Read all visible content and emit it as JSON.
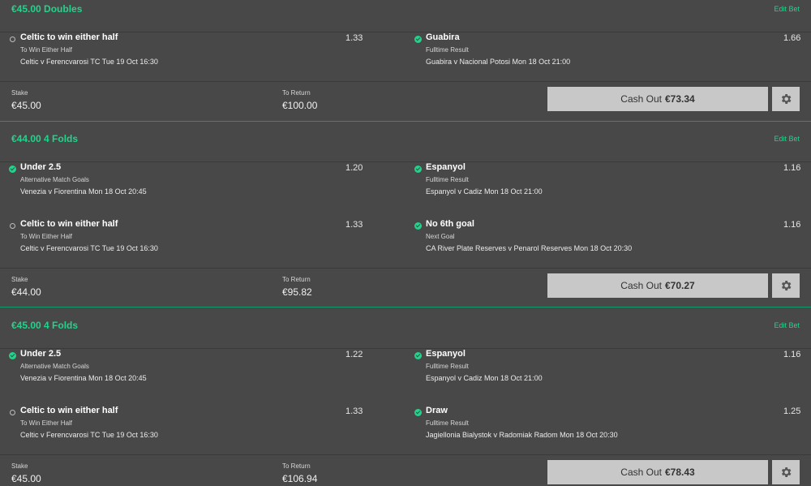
{
  "colors": {
    "accent": "#22d38c",
    "background": "#484848",
    "cashout_bg": "#c8c8c8"
  },
  "icons": {
    "won": "check-circle-icon",
    "open": "open-circle-icon",
    "settings": "gear-icon"
  },
  "bets": [
    {
      "title": "€45.00 Doubles",
      "edit_label": "Edit Bet",
      "legs": [
        {
          "status": "open",
          "selection": "Celtic to win either half",
          "market": "To Win Either Half",
          "event": "Celtic v Ferencvarosi TC   Tue 19 Oct 16:30",
          "odds": "1.33"
        },
        {
          "status": "won",
          "selection": "Guabira",
          "market": "Fulltime Result",
          "event": "Guabira v Nacional Potosi   Mon 18 Oct 21:00",
          "odds": "1.66"
        }
      ],
      "stake_label": "Stake",
      "stake": "€45.00",
      "return_label": "To Return",
      "return": "€100.00",
      "cashout_label": "Cash Out",
      "cashout_value": "€73.34"
    },
    {
      "title": "€44.00 4 Folds",
      "edit_label": "Edit Bet",
      "legs": [
        {
          "status": "won",
          "selection": "Under 2.5",
          "market": "Alternative Match Goals",
          "event": "Venezia v Fiorentina   Mon 18 Oct 20:45",
          "odds": "1.20"
        },
        {
          "status": "won",
          "selection": "Espanyol",
          "market": "Fulltime Result",
          "event": "Espanyol v Cadiz   Mon 18 Oct 21:00",
          "odds": "1.16"
        },
        {
          "status": "open",
          "selection": "Celtic to win either half",
          "market": "To Win Either Half",
          "event": "Celtic v Ferencvarosi TC   Tue 19 Oct 16:30",
          "odds": "1.33"
        },
        {
          "status": "won",
          "selection": "No 6th goal",
          "market": "Next Goal",
          "event": "CA River Plate Reserves v Penarol Reserves   Mon 18 Oct 20:30",
          "odds": "1.16"
        }
      ],
      "stake_label": "Stake",
      "stake": "€44.00",
      "return_label": "To Return",
      "return": "€95.82",
      "cashout_label": "Cash Out",
      "cashout_value": "€70.27"
    },
    {
      "title": "€45.00 4 Folds",
      "edit_label": "Edit Bet",
      "legs": [
        {
          "status": "won",
          "selection": "Under 2.5",
          "market": "Alternative Match Goals",
          "event": "Venezia v Fiorentina   Mon 18 Oct 20:45",
          "odds": "1.22"
        },
        {
          "status": "won",
          "selection": "Espanyol",
          "market": "Fulltime Result",
          "event": "Espanyol v Cadiz   Mon 18 Oct 21:00",
          "odds": "1.16"
        },
        {
          "status": "open",
          "selection": "Celtic to win either half",
          "market": "To Win Either Half",
          "event": "Celtic v Ferencvarosi TC   Tue 19 Oct 16:30",
          "odds": "1.33"
        },
        {
          "status": "won",
          "selection": "Draw",
          "market": "Fulltime Result",
          "event": "Jagiellonia Bialystok v Radomiak Radom   Mon 18 Oct 20:30",
          "odds": "1.25"
        }
      ],
      "stake_label": "Stake",
      "stake": "€45.00",
      "return_label": "To Return",
      "return": "€106.94",
      "cashout_label": "Cash Out",
      "cashout_value": "€78.43"
    }
  ]
}
